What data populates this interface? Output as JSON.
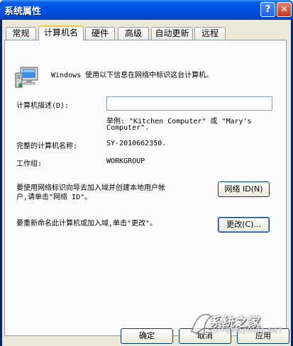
{
  "window": {
    "title": "系统属性"
  },
  "titlebar_buttons": {
    "help": "?",
    "close": "✕"
  },
  "tabs": [
    {
      "label": "常规"
    },
    {
      "label": "计算机名"
    },
    {
      "label": "硬件"
    },
    {
      "label": "高级"
    },
    {
      "label": "自动更新"
    },
    {
      "label": "远程"
    }
  ],
  "panel": {
    "intro": "Windows 使用以下信息在网络中标识这台计算机。",
    "description_label": "计算机描述(D):",
    "description_value": "",
    "example_line1": "举例: \"Kitchen Computer\" 或 \"Mary's",
    "example_line2": "Computer\".",
    "full_name_label": "完整的计算机名称:",
    "full_name_value": "SY-2010662350.",
    "workgroup_label": "工作组:",
    "workgroup_value": "WORKGROUP",
    "network_text_line1": "要使用网络标识向导去加入域并创建本地用户帐",
    "network_text_line2": "户,请单击\"网络 ID\"。",
    "network_button": "网络 ID(N)",
    "rename_text": "要重新命名此计算机或加入域,单击\"更改\"。",
    "change_button": "更改(C)..."
  },
  "footer": {
    "ok": "确定",
    "cancel": "取消",
    "apply": "应用"
  },
  "watermark": {
    "text": "系统之家",
    "url": "XITONGZHIJIA.NET"
  }
}
